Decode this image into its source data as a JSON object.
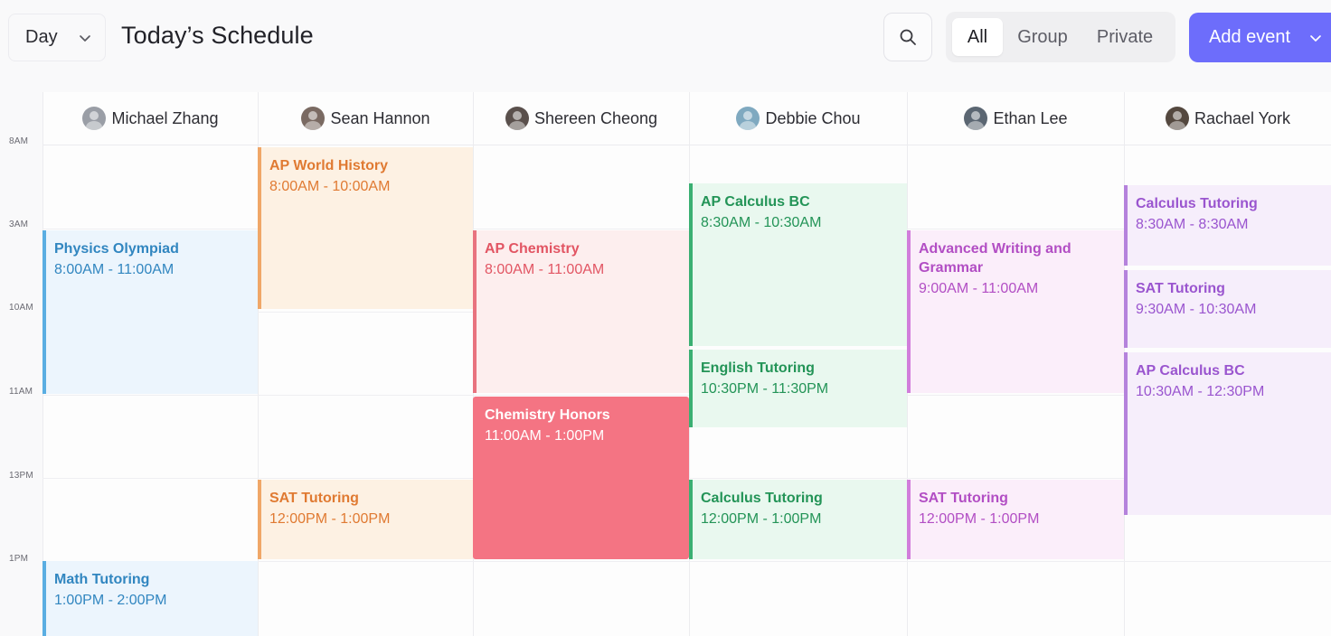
{
  "toolbar": {
    "view_select": {
      "label": "Day",
      "icon": "chevron-down-icon"
    },
    "title": "Today’s Schedule",
    "search_icon": "search-icon",
    "filters": [
      {
        "label": "All",
        "active": true
      },
      {
        "label": "Group",
        "active": false
      },
      {
        "label": "Private",
        "active": false
      }
    ],
    "add_event": {
      "label": "Add event",
      "icon": "chevron-down-icon"
    }
  },
  "colors": {
    "accent": "#6d6dfb",
    "blue": "#5aaee2",
    "orange": "#f0a768",
    "red": "#e8737f",
    "green": "#3aaf72",
    "pink": "#d17ddb",
    "purple": "#b582dc"
  },
  "time_labels": [
    "8AM",
    "3AM",
    "10AM",
    "11AM",
    "13PM",
    "1PM"
  ],
  "people": [
    {
      "name": "Michael Zhang",
      "avatar_color": "#9a9ea6"
    },
    {
      "name": "Sean Hannon",
      "avatar_color": "#7a6a62"
    },
    {
      "name": "Shereen Cheong",
      "avatar_color": "#5a504c"
    },
    {
      "name": "Debbie Chou",
      "avatar_color": "#7fa9c0"
    },
    {
      "name": "Ethan Lee",
      "avatar_color": "#5b6672"
    },
    {
      "name": "Rachael York",
      "avatar_color": "#54483f"
    }
  ],
  "events": [
    {
      "title": "Physics Olympiad",
      "time": "8:00AM - 11:00AM",
      "color": "blue"
    },
    {
      "title": "Math Tutoring",
      "time": "1:00PM - 2:00PM",
      "color": "blue"
    },
    {
      "title": "AP World History",
      "time": "8:00AM - 10:00AM",
      "color": "orange"
    },
    {
      "title": "SAT Tutoring",
      "time": "12:00PM - 1:00PM",
      "color": "orange"
    },
    {
      "title": "AP Chemistry",
      "time": "8:00AM - 11:00AM",
      "color": "red"
    },
    {
      "title": "Chemistry Honors",
      "time": "11:00AM - 1:00PM",
      "color": "redsolid"
    },
    {
      "title": "AP Calculus BC",
      "time": "8:30AM - 10:30AM",
      "color": "green"
    },
    {
      "title": "English Tutoring",
      "time": "10:30PM - 11:30PM",
      "color": "green"
    },
    {
      "title": "Calculus Tutoring",
      "time": "12:00PM - 1:00PM",
      "color": "green"
    },
    {
      "title": "Advanced Writing and Grammar",
      "time": "9:00AM - 11:00AM",
      "color": "pink"
    },
    {
      "title": "SAT Tutoring",
      "time": "12:00PM - 1:00PM",
      "color": "pink"
    },
    {
      "title": "Calculus Tutoring",
      "time": "8:30AM - 8:30AM",
      "color": "purple"
    },
    {
      "title": "SAT Tutoring",
      "time": "9:30AM - 10:30AM",
      "color": "purple"
    },
    {
      "title": "AP Calculus BC",
      "time": "10:30AM - 12:30PM",
      "color": "purple"
    }
  ]
}
